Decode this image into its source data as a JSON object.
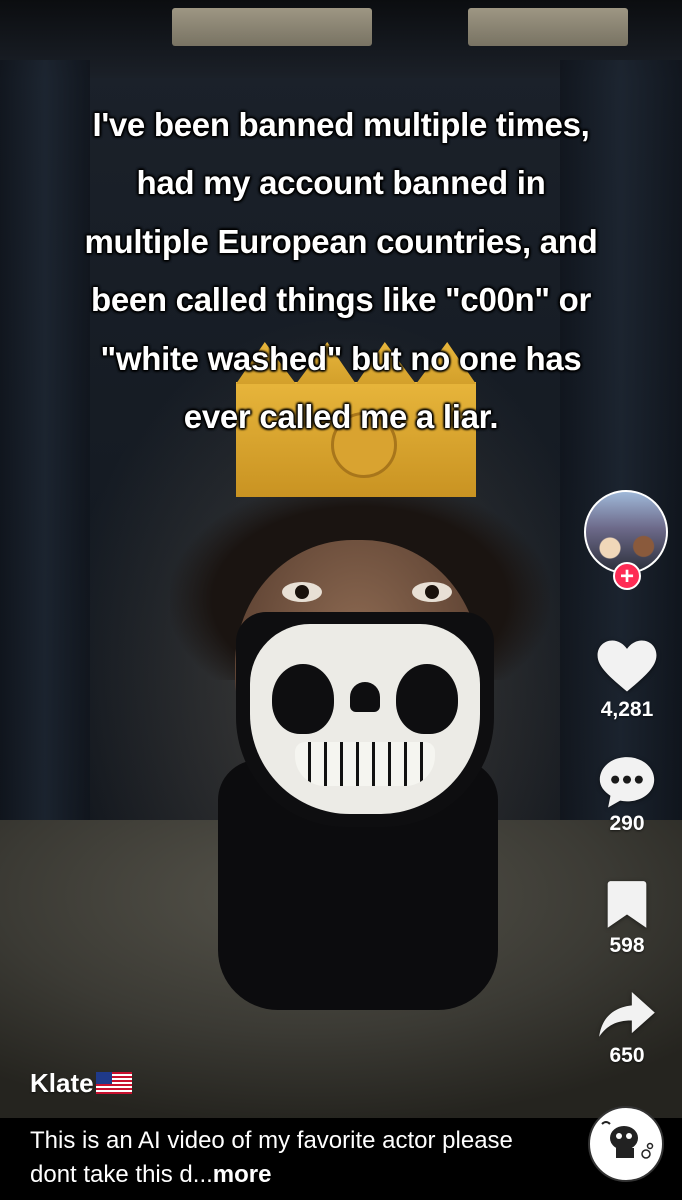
{
  "caption": {
    "lines": [
      "I've been banned multiple times,",
      "had my account banned in",
      "multiple European countries, and",
      "been called things like \"c00n\" or",
      "\"white washed\" but no one has",
      "ever called me a liar."
    ]
  },
  "actions": {
    "likes": "4,281",
    "comments": "290",
    "bookmarks": "598",
    "shares": "650"
  },
  "creator": {
    "username": "Klate",
    "flag_icon": "us-flag-icon"
  },
  "description": {
    "text": "This is an AI video of my favorite actor please dont take this d...",
    "more_label": "more"
  },
  "colors": {
    "follow_accent": "#fe2c55",
    "text": "#ffffff"
  },
  "icons": {
    "follow": "plus-icon",
    "like": "heart-icon",
    "comment": "comment-icon",
    "bookmark": "bookmark-icon",
    "share": "share-icon",
    "sound": "sound-disc-icon"
  }
}
